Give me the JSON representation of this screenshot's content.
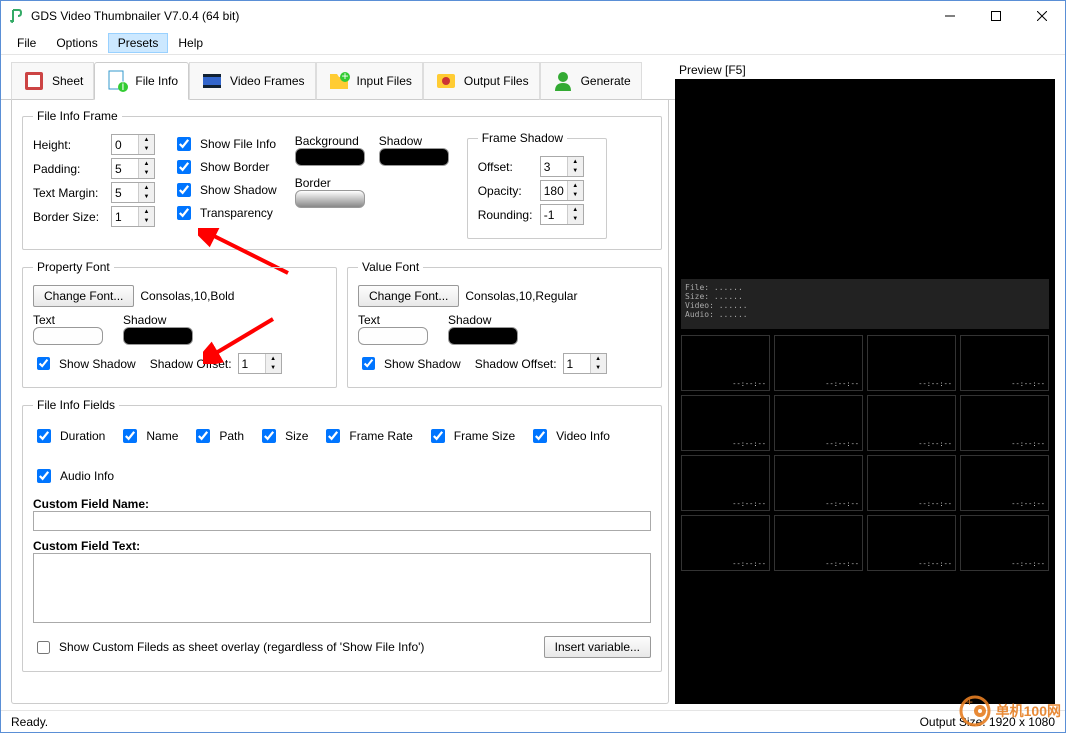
{
  "window": {
    "title": "GDS Video Thumbnailer V7.0.4 (64 bit)"
  },
  "menu": {
    "file": "File",
    "options": "Options",
    "presets": "Presets",
    "help": "Help"
  },
  "tabs": {
    "sheet": "Sheet",
    "file_info": "File Info",
    "video_frames": "Video Frames",
    "input_files": "Input Files",
    "output_files": "Output Files",
    "generate": "Generate"
  },
  "file_info_frame": {
    "legend": "File Info Frame",
    "height_label": "Height:",
    "height": "0",
    "padding_label": "Padding:",
    "padding": "5",
    "text_margin_label": "Text Margin:",
    "text_margin": "5",
    "border_size_label": "Border Size:",
    "border_size": "1",
    "show_file_info": "Show File Info",
    "show_border": "Show Border",
    "show_shadow": "Show Shadow",
    "transparency": "Transparency",
    "background_label": "Background",
    "shadow_label": "Shadow",
    "border_label": "Border"
  },
  "frame_shadow": {
    "legend": "Frame Shadow",
    "offset_label": "Offset:",
    "offset": "3",
    "opacity_label": "Opacity:",
    "opacity": "180",
    "rounding_label": "Rounding:",
    "rounding": "-1"
  },
  "property_font": {
    "legend": "Property Font",
    "change_font": "Change Font...",
    "desc": "Consolas,10,Bold",
    "text_label": "Text",
    "shadow_label": "Shadow",
    "show_shadow": "Show Shadow",
    "shadow_offset_label": "Shadow Offset:",
    "shadow_offset": "1"
  },
  "value_font": {
    "legend": "Value Font",
    "change_font": "Change Font...",
    "desc": "Consolas,10,Regular",
    "text_label": "Text",
    "shadow_label": "Shadow",
    "show_shadow": "Show Shadow",
    "shadow_offset_label": "Shadow Offset:",
    "shadow_offset": "1"
  },
  "fields": {
    "legend": "File Info Fields",
    "duration": "Duration",
    "name": "Name",
    "path": "Path",
    "size": "Size",
    "frame_rate": "Frame Rate",
    "frame_size": "Frame Size",
    "video_info": "Video Info",
    "audio_info": "Audio Info",
    "custom_name_label": "Custom Field Name:",
    "custom_text_label": "Custom Field Text:",
    "overlay_cb": "Show Custom Fileds as sheet overlay (regardless of 'Show File Info')",
    "insert_var": "Insert variable..."
  },
  "preview": {
    "label": "Preview  [F5]"
  },
  "status": {
    "ready": "Ready.",
    "output": "Output Size: 1920 x 1080"
  },
  "watermark": {
    "text": "单机100网"
  }
}
